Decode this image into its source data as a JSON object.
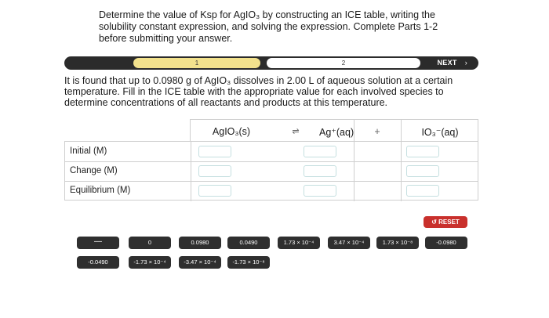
{
  "question": {
    "text": "Determine the value of Ksp for AgIO₃ by constructing an ICE table, writing the solubility constant expression, and solving the expression. Complete Parts 1-2 before submitting your answer."
  },
  "progress": {
    "step1_label": "1",
    "step2_label": "2",
    "next_label": "NEXT",
    "current_step": 1,
    "total_steps": 2
  },
  "part": {
    "text": "It is found that up to 0.0980 g of AgIO₃ dissolves in 2.00 L of aqueous solution at a certain temperature. Fill in the ICE table with the appropriate value for each involved species to determine concentrations of all reactants and products at this temperature."
  },
  "ice_table": {
    "columns": [
      "AgIO₃(s)",
      "⇌",
      "Ag⁺(aq)",
      "+",
      "IO₃⁻(aq)"
    ],
    "rows": [
      "Initial (M)",
      "Change (M)",
      "Equilibrium (M)"
    ]
  },
  "answers": {
    "row1": [
      "—",
      "0",
      "0.0980",
      "0.0490",
      "1.73 × 10⁻⁴",
      "3.47 × 10⁻⁴",
      "1.73 × 10⁻⁸",
      "-0.0980"
    ],
    "row2": [
      "-0.0490",
      "-1.73 × 10⁻⁴",
      "-3.47 × 10⁻⁴",
      "-1.73 × 10⁻⁸"
    ]
  },
  "reset_label": "RESET",
  "colors": {
    "progress_track": "#2b2b2b",
    "step_active": "#f3e28d",
    "answer_tile": "#2f2f2f",
    "reset": "#c9302c",
    "input_border": "#c5dfe0"
  }
}
